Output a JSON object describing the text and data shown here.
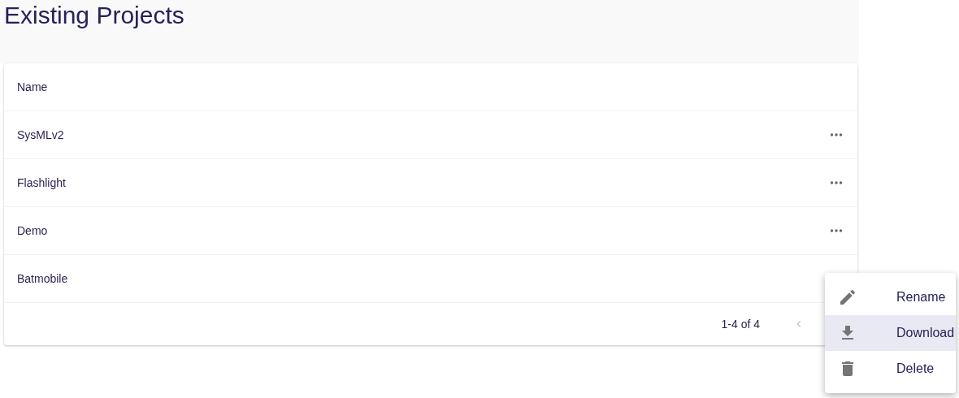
{
  "page": {
    "title": "Existing Projects"
  },
  "table": {
    "columns": [
      "Name"
    ],
    "rows": [
      {
        "name": "SysMLv2",
        "menu_open": false
      },
      {
        "name": "Flashlight",
        "menu_open": false
      },
      {
        "name": "Demo",
        "menu_open": false
      },
      {
        "name": "Batmobile",
        "menu_open": true
      }
    ],
    "pagination": {
      "range": "1-4 of 4",
      "previous_disabled": true
    }
  },
  "context_menu": {
    "items": [
      {
        "kind": "rename",
        "label": "Rename",
        "highlighted": false
      },
      {
        "kind": "download",
        "label": "Download",
        "highlighted": true
      },
      {
        "kind": "delete",
        "label": "Delete",
        "highlighted": false
      }
    ]
  }
}
